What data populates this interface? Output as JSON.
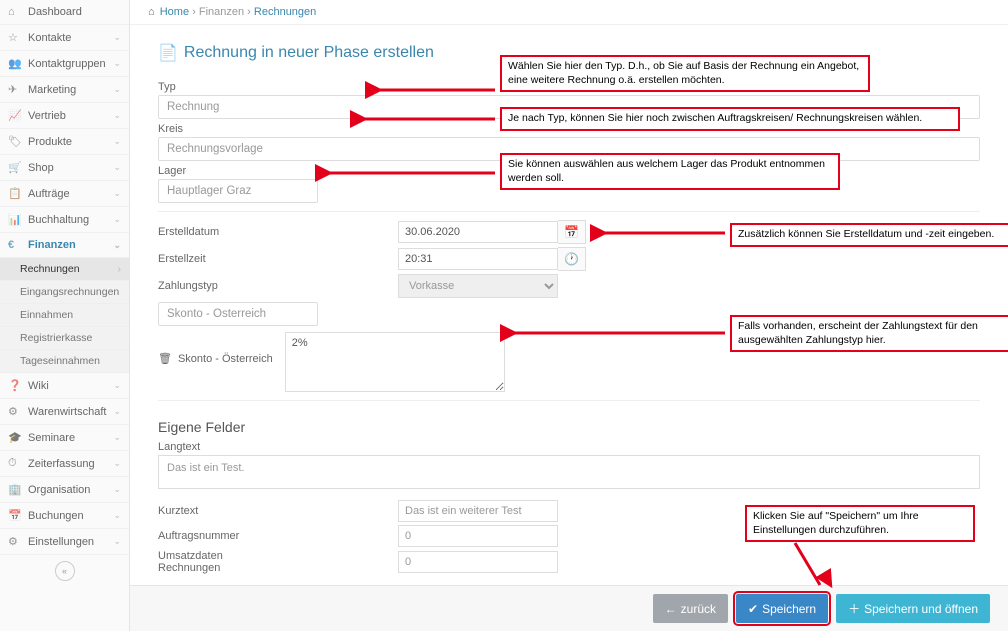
{
  "breadcrumb": {
    "home": "Home",
    "section": "Finanzen",
    "page": "Rechnungen"
  },
  "title": "Rechnung in neuer Phase erstellen",
  "sidebar": {
    "items": [
      {
        "label": "Dashboard",
        "icon": "⌂"
      },
      {
        "label": "Kontakte",
        "icon": "☆",
        "chev": true
      },
      {
        "label": "Kontaktgruppen",
        "icon": "👥",
        "chev": true
      },
      {
        "label": "Marketing",
        "icon": "✈",
        "chev": true
      },
      {
        "label": "Vertrieb",
        "icon": "📈",
        "chev": true
      },
      {
        "label": "Produkte",
        "icon": "🏷",
        "chev": true
      },
      {
        "label": "Shop",
        "icon": "🛒",
        "chev": true
      },
      {
        "label": "Aufträge",
        "icon": "📋",
        "chev": true
      },
      {
        "label": "Buchhaltung",
        "icon": "📊",
        "chev": true
      },
      {
        "label": "Finanzen",
        "icon": "€",
        "chev": true,
        "active": true
      },
      {
        "label": "Wiki",
        "icon": "❓",
        "chev": true
      },
      {
        "label": "Warenwirtschaft",
        "icon": "⚙",
        "chev": true
      },
      {
        "label": "Seminare",
        "icon": "🎓",
        "chev": true
      },
      {
        "label": "Zeiterfassung",
        "icon": "⏱",
        "chev": true
      },
      {
        "label": "Organisation",
        "icon": "🏢",
        "chev": true
      },
      {
        "label": "Buchungen",
        "icon": "📅",
        "chev": true
      },
      {
        "label": "Einstellungen",
        "icon": "⚙",
        "chev": true
      }
    ],
    "finanzen_sub": [
      "Rechnungen",
      "Eingangsrechnungen",
      "Einnahmen",
      "Registrierkasse",
      "Tageseinnahmen"
    ]
  },
  "form": {
    "typ_label": "Typ",
    "typ_value": "Rechnung",
    "kreis_label": "Kreis",
    "kreis_value": "Rechnungsvorlage",
    "lager_label": "Lager",
    "lager_value": "Hauptlager Graz",
    "erstelldatum_label": "Erstelldatum",
    "erstelldatum_value": "30.06.2020",
    "erstellzeit_label": "Erstellzeit",
    "erstellzeit_value": "20:31",
    "zahlungstyp_label": "Zahlungstyp",
    "zahlungstyp_value": "Vorkasse",
    "skonto_select": "Skonto - Österreich",
    "skonto_label": "Skonto - Österreich",
    "skonto_text": "2%",
    "eigene_felder_h": "Eigene Felder",
    "langtext_label": "Langtext",
    "langtext_value": "Das ist ein Test.",
    "kurztext_label": "Kurztext",
    "kurztext_value": "Das ist ein weiterer Test",
    "auftragsnummer_label": "Auftragsnummer",
    "auftragsnummer_value": "0",
    "umsatz_label": "Umsatzdaten Rechnungen",
    "umsatz_value": "0"
  },
  "buttons": {
    "back": "zurück",
    "save": "Speichern",
    "save_open": "Speichern und öffnen"
  },
  "annotations": {
    "typ": "Wählen Sie hier den Typ. D.h., ob Sie auf Basis der Rechnung ein Angebot, eine weitere Rechnung o.ä. erstellen möchten.",
    "kreis": "Je nach Typ, können Sie hier noch zwischen Auftragskreisen/ Rechnungskreisen wählen.",
    "lager": "Sie können auswählen aus welchem Lager das Produkt entnommen werden soll.",
    "datum": "Zusätzlich können Sie Erstelldatum und -zeit eingeben.",
    "zahlungstext": "Falls vorhanden, erscheint der Zahlungstext für den ausgewählten Zahlungstyp hier.",
    "speichern": "Klicken Sie auf \"Speichern\" um Ihre Einstellungen durchzuführen."
  }
}
